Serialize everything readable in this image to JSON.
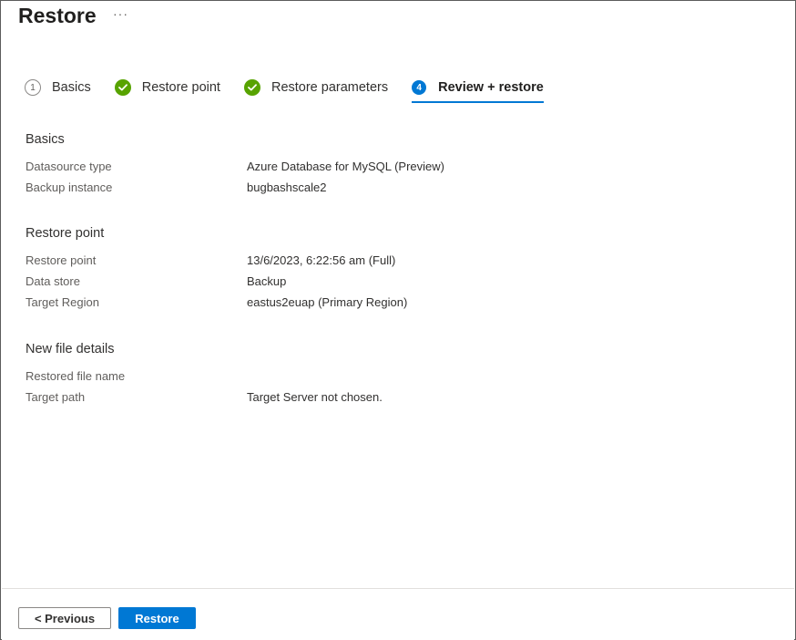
{
  "header": {
    "title": "Restore",
    "more_label": "···"
  },
  "wizard": {
    "steps": [
      {
        "number": "1",
        "label": "Basics",
        "state": "pending"
      },
      {
        "label": "Restore point",
        "state": "complete"
      },
      {
        "label": "Restore parameters",
        "state": "complete"
      },
      {
        "number": "4",
        "label": "Review + restore",
        "state": "active"
      }
    ]
  },
  "sections": {
    "basics": {
      "title": "Basics",
      "rows": [
        {
          "label": "Datasource type",
          "value": "Azure Database for MySQL (Preview)"
        },
        {
          "label": "Backup instance",
          "value": "bugbashscale2"
        }
      ]
    },
    "restore_point": {
      "title": "Restore point",
      "rows": [
        {
          "label": "Restore point",
          "value": "13/6/2023, 6:22:56 am (Full)"
        },
        {
          "label": "Data store",
          "value": "Backup"
        },
        {
          "label": "Target Region",
          "value": "eastus2euap (Primary Region)"
        }
      ]
    },
    "new_file": {
      "title": "New file details",
      "rows": [
        {
          "label": "Restored file name",
          "value": ""
        },
        {
          "label": "Target path",
          "value": "Target Server not chosen."
        }
      ]
    }
  },
  "footer": {
    "previous_label": "< Previous",
    "restore_label": "Restore"
  },
  "colors": {
    "accent": "#0078d4",
    "success": "#57a300"
  }
}
